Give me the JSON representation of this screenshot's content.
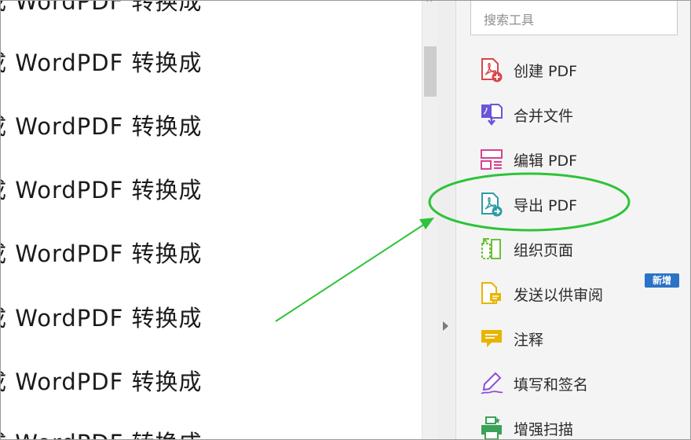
{
  "document": {
    "lines": [
      "WordPDF 转换成",
      "WordPDF 转换成",
      "WordPDF 转换成",
      "WordPDF 转换成",
      "WordPDF 转换成",
      "WordPDF 转换成",
      "WordPDF 转换成",
      "WordPDF 转换成"
    ],
    "left_char": "成"
  },
  "tools_pane": {
    "search_placeholder": "搜索工具",
    "new_badge": "新增",
    "items": [
      {
        "label": "创建 PDF",
        "icon": "create-pdf-icon",
        "color": "#d8464b"
      },
      {
        "label": "合并文件",
        "icon": "combine-files-icon",
        "color": "#6b55d8"
      },
      {
        "label": "编辑 PDF",
        "icon": "edit-pdf-icon",
        "color": "#d9418f"
      },
      {
        "label": "导出 PDF",
        "icon": "export-pdf-icon",
        "color": "#2e9aa6"
      },
      {
        "label": "组织页面",
        "icon": "organize-pages-icon",
        "color": "#6fbf3a"
      },
      {
        "label": "发送以供审阅",
        "icon": "send-for-review-icon",
        "color": "#e8b400"
      },
      {
        "label": "注释",
        "icon": "comment-icon",
        "color": "#e8b400"
      },
      {
        "label": "填写和签名",
        "icon": "fill-sign-icon",
        "color": "#8a4ed8"
      },
      {
        "label": "增强扫描",
        "icon": "enhance-scans-icon",
        "color": "#3aa25a"
      }
    ]
  },
  "annotation_colors": {
    "highlight": "#2ec33a"
  }
}
